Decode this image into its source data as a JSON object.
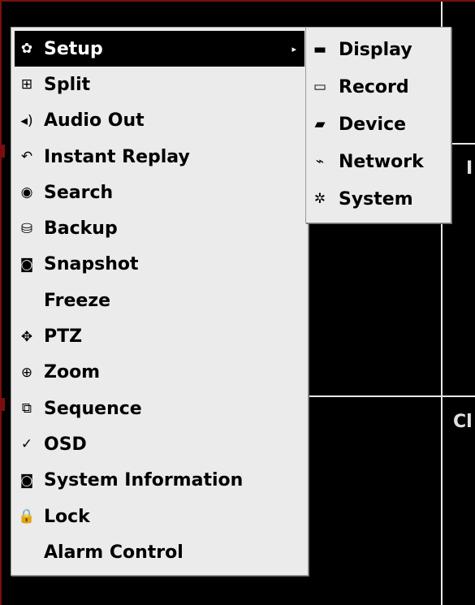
{
  "main_menu": {
    "items": [
      {
        "label": "Setup",
        "icon": "gear-icon",
        "glyph": "✿",
        "has_submenu": true,
        "selected": true
      },
      {
        "label": "Split",
        "icon": "split-grid-icon",
        "glyph": "⊞"
      },
      {
        "label": "Audio Out",
        "icon": "speaker-icon",
        "glyph": "◂)"
      },
      {
        "label": "Instant Replay",
        "icon": "replay-icon",
        "glyph": "↶"
      },
      {
        "label": "Search",
        "icon": "search-icon",
        "glyph": "◉"
      },
      {
        "label": "Backup",
        "icon": "backup-icon",
        "glyph": "⛁"
      },
      {
        "label": "Snapshot",
        "icon": "camera-icon",
        "glyph": "◙"
      },
      {
        "label": "Freeze",
        "icon": "",
        "glyph": ""
      },
      {
        "label": "PTZ",
        "icon": "ptz-move-icon",
        "glyph": "✥"
      },
      {
        "label": "Zoom",
        "icon": "zoom-icon",
        "glyph": "⊕"
      },
      {
        "label": "Sequence",
        "icon": "sequence-icon",
        "glyph": "⧉"
      },
      {
        "label": "OSD",
        "icon": "check-icon",
        "glyph": "✓"
      },
      {
        "label": "System Information",
        "icon": "info-icon",
        "glyph": "◙"
      },
      {
        "label": "Lock",
        "icon": "lock-icon",
        "glyph": "🔒"
      },
      {
        "label": "Alarm Control",
        "icon": "",
        "glyph": ""
      }
    ],
    "submenu_arrow": "▸"
  },
  "setup_submenu": {
    "items": [
      {
        "label": "Display",
        "icon": "monitor-icon",
        "glyph": "▬"
      },
      {
        "label": "Record",
        "icon": "record-icon",
        "glyph": "▭"
      },
      {
        "label": "Device",
        "icon": "device-icon",
        "glyph": "▰"
      },
      {
        "label": "Network",
        "icon": "network-icon",
        "glyph": "⌁"
      },
      {
        "label": "System",
        "icon": "system-icon",
        "glyph": "✲"
      }
    ]
  },
  "background": {
    "camera_labels": [
      "I",
      "Cl"
    ]
  }
}
